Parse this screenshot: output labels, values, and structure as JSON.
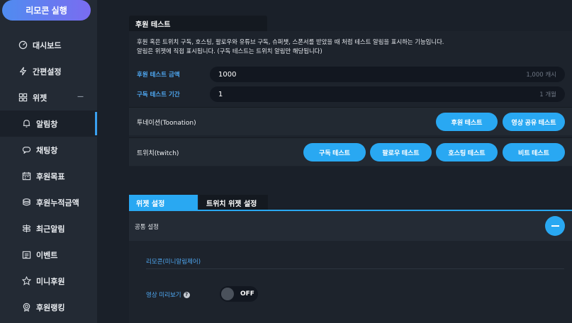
{
  "sidebar": {
    "run_button": "리모콘 실행",
    "items": [
      {
        "label": "대시보드",
        "icon": "dashboard-icon"
      },
      {
        "label": "간편설정",
        "icon": "lightning-icon"
      },
      {
        "label": "위젯",
        "icon": "widget-icon"
      },
      {
        "label": "알림창",
        "icon": "bell-icon"
      },
      {
        "label": "채팅창",
        "icon": "chat-icon"
      },
      {
        "label": "후원목표",
        "icon": "calendar-icon"
      },
      {
        "label": "후원누적금액",
        "icon": "coins-icon"
      },
      {
        "label": "최근알림",
        "icon": "signpost-icon"
      },
      {
        "label": "이벤트",
        "icon": "event-icon"
      },
      {
        "label": "미니후원",
        "icon": "star-icon"
      },
      {
        "label": "후원랭킹",
        "icon": "medal-icon"
      }
    ],
    "active_item": "알림창"
  },
  "donation_test": {
    "title": "후원 테스트",
    "description_line1": "후원 혹은 트위치 구독, 호스팅, 팔로우와 유튜브 구독, 슈퍼챗, 스폰서를 받았을 때 처럼 테스트 알림을 표시하는 기능입니다.",
    "description_line2": "알림은 위젯에 직접 표시됩니다. (구독 테스트는 트위치 알림만 해당됩니다)",
    "amount_label": "후원 테스트 금액",
    "amount_value": "1000",
    "amount_unit": "1,000 캐시",
    "period_label": "구독 테스트 기간",
    "period_value": "1",
    "period_unit": "1 개월",
    "toonation": {
      "label": "투네이션(Toonation)",
      "buttons": [
        "후원 테스트",
        "영상 공유 테스트"
      ]
    },
    "twitch": {
      "label": "트위치(twitch)",
      "buttons": [
        "구독 테스트",
        "팔로우 테스트",
        "호스팅 테스트",
        "비트 테스트"
      ]
    }
  },
  "widget_settings": {
    "tabs": [
      "위젯 설정",
      "트위치 위젯 설정"
    ],
    "active_tab": "위젯 설정",
    "common_title": "공통 설정",
    "subsection_title": "리모콘(미니알림제어)",
    "preview_label": "영상 미리보기",
    "preview_toggle": "OFF",
    "accent_color": "#29a8f2"
  }
}
